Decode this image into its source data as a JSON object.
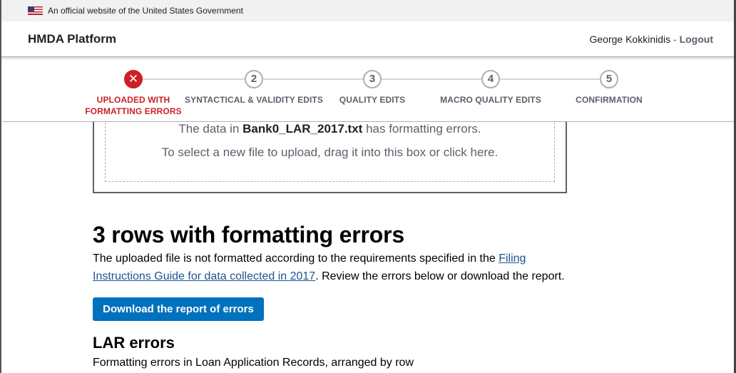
{
  "gov_banner": {
    "text": "An official website of the United States Government"
  },
  "header": {
    "brand": "HMDA Platform",
    "user_name": "George Kokkinidis",
    "separator": " - ",
    "logout": "Logout"
  },
  "progress": {
    "steps": [
      {
        "icon": "✕",
        "line1": "UPLOADED WITH",
        "line2": "FORMATTING ERRORS",
        "status": "error"
      },
      {
        "icon": "2",
        "line1": "SYNTACTICAL & VALIDITY EDITS",
        "line2": "",
        "status": "pending"
      },
      {
        "icon": "3",
        "line1": "QUALITY EDITS",
        "line2": "",
        "status": "pending"
      },
      {
        "icon": "4",
        "line1": "MACRO QUALITY EDITS",
        "line2": "",
        "status": "pending"
      },
      {
        "icon": "5",
        "line1": "CONFIRMATION",
        "line2": "",
        "status": "pending"
      }
    ]
  },
  "dropzone": {
    "line1_prefix": "The data in ",
    "filename": "Bank0_LAR_2017.txt",
    "line1_suffix": " has formatting errors.",
    "line2": "To select a new file to upload, drag it into this box or click here."
  },
  "main": {
    "title": "3 rows with formatting errors",
    "lede_prefix": "The uploaded file is not formatted according to the requirements specified in the ",
    "lede_link": "Filing Instructions Guide for data collected in 2017",
    "lede_suffix": ". Review the errors below or download the report.",
    "download_button": "Download the report of errors",
    "lar_title": "LAR errors",
    "lar_desc": "Formatting errors in Loan Application Records, arranged by row"
  },
  "colors": {
    "error": "#cd2026",
    "primary_button": "#0071bc",
    "link": "#205493",
    "muted": "#5b616b"
  }
}
